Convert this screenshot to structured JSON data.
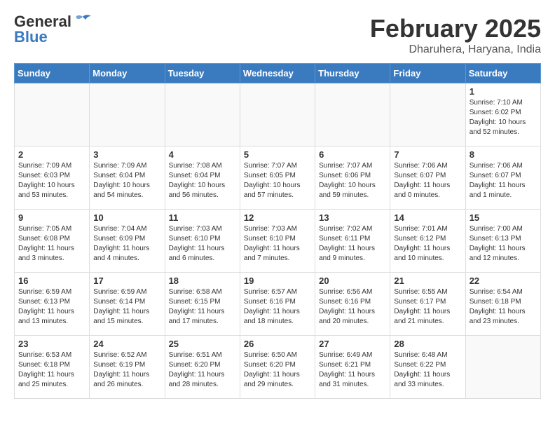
{
  "header": {
    "logo_general": "General",
    "logo_blue": "Blue",
    "title": "February 2025",
    "location": "Dharuhera, Haryana, India"
  },
  "calendar": {
    "days_of_week": [
      "Sunday",
      "Monday",
      "Tuesday",
      "Wednesday",
      "Thursday",
      "Friday",
      "Saturday"
    ],
    "weeks": [
      [
        {
          "day": "",
          "info": ""
        },
        {
          "day": "",
          "info": ""
        },
        {
          "day": "",
          "info": ""
        },
        {
          "day": "",
          "info": ""
        },
        {
          "day": "",
          "info": ""
        },
        {
          "day": "",
          "info": ""
        },
        {
          "day": "1",
          "info": "Sunrise: 7:10 AM\nSunset: 6:02 PM\nDaylight: 10 hours\nand 52 minutes."
        }
      ],
      [
        {
          "day": "2",
          "info": "Sunrise: 7:09 AM\nSunset: 6:03 PM\nDaylight: 10 hours\nand 53 minutes."
        },
        {
          "day": "3",
          "info": "Sunrise: 7:09 AM\nSunset: 6:04 PM\nDaylight: 10 hours\nand 54 minutes."
        },
        {
          "day": "4",
          "info": "Sunrise: 7:08 AM\nSunset: 6:04 PM\nDaylight: 10 hours\nand 56 minutes."
        },
        {
          "day": "5",
          "info": "Sunrise: 7:07 AM\nSunset: 6:05 PM\nDaylight: 10 hours\nand 57 minutes."
        },
        {
          "day": "6",
          "info": "Sunrise: 7:07 AM\nSunset: 6:06 PM\nDaylight: 10 hours\nand 59 minutes."
        },
        {
          "day": "7",
          "info": "Sunrise: 7:06 AM\nSunset: 6:07 PM\nDaylight: 11 hours\nand 0 minutes."
        },
        {
          "day": "8",
          "info": "Sunrise: 7:06 AM\nSunset: 6:07 PM\nDaylight: 11 hours\nand 1 minute."
        }
      ],
      [
        {
          "day": "9",
          "info": "Sunrise: 7:05 AM\nSunset: 6:08 PM\nDaylight: 11 hours\nand 3 minutes."
        },
        {
          "day": "10",
          "info": "Sunrise: 7:04 AM\nSunset: 6:09 PM\nDaylight: 11 hours\nand 4 minutes."
        },
        {
          "day": "11",
          "info": "Sunrise: 7:03 AM\nSunset: 6:10 PM\nDaylight: 11 hours\nand 6 minutes."
        },
        {
          "day": "12",
          "info": "Sunrise: 7:03 AM\nSunset: 6:10 PM\nDaylight: 11 hours\nand 7 minutes."
        },
        {
          "day": "13",
          "info": "Sunrise: 7:02 AM\nSunset: 6:11 PM\nDaylight: 11 hours\nand 9 minutes."
        },
        {
          "day": "14",
          "info": "Sunrise: 7:01 AM\nSunset: 6:12 PM\nDaylight: 11 hours\nand 10 minutes."
        },
        {
          "day": "15",
          "info": "Sunrise: 7:00 AM\nSunset: 6:13 PM\nDaylight: 11 hours\nand 12 minutes."
        }
      ],
      [
        {
          "day": "16",
          "info": "Sunrise: 6:59 AM\nSunset: 6:13 PM\nDaylight: 11 hours\nand 13 minutes."
        },
        {
          "day": "17",
          "info": "Sunrise: 6:59 AM\nSunset: 6:14 PM\nDaylight: 11 hours\nand 15 minutes."
        },
        {
          "day": "18",
          "info": "Sunrise: 6:58 AM\nSunset: 6:15 PM\nDaylight: 11 hours\nand 17 minutes."
        },
        {
          "day": "19",
          "info": "Sunrise: 6:57 AM\nSunset: 6:16 PM\nDaylight: 11 hours\nand 18 minutes."
        },
        {
          "day": "20",
          "info": "Sunrise: 6:56 AM\nSunset: 6:16 PM\nDaylight: 11 hours\nand 20 minutes."
        },
        {
          "day": "21",
          "info": "Sunrise: 6:55 AM\nSunset: 6:17 PM\nDaylight: 11 hours\nand 21 minutes."
        },
        {
          "day": "22",
          "info": "Sunrise: 6:54 AM\nSunset: 6:18 PM\nDaylight: 11 hours\nand 23 minutes."
        }
      ],
      [
        {
          "day": "23",
          "info": "Sunrise: 6:53 AM\nSunset: 6:18 PM\nDaylight: 11 hours\nand 25 minutes."
        },
        {
          "day": "24",
          "info": "Sunrise: 6:52 AM\nSunset: 6:19 PM\nDaylight: 11 hours\nand 26 minutes."
        },
        {
          "day": "25",
          "info": "Sunrise: 6:51 AM\nSunset: 6:20 PM\nDaylight: 11 hours\nand 28 minutes."
        },
        {
          "day": "26",
          "info": "Sunrise: 6:50 AM\nSunset: 6:20 PM\nDaylight: 11 hours\nand 29 minutes."
        },
        {
          "day": "27",
          "info": "Sunrise: 6:49 AM\nSunset: 6:21 PM\nDaylight: 11 hours\nand 31 minutes."
        },
        {
          "day": "28",
          "info": "Sunrise: 6:48 AM\nSunset: 6:22 PM\nDaylight: 11 hours\nand 33 minutes."
        },
        {
          "day": "",
          "info": ""
        }
      ]
    ]
  }
}
